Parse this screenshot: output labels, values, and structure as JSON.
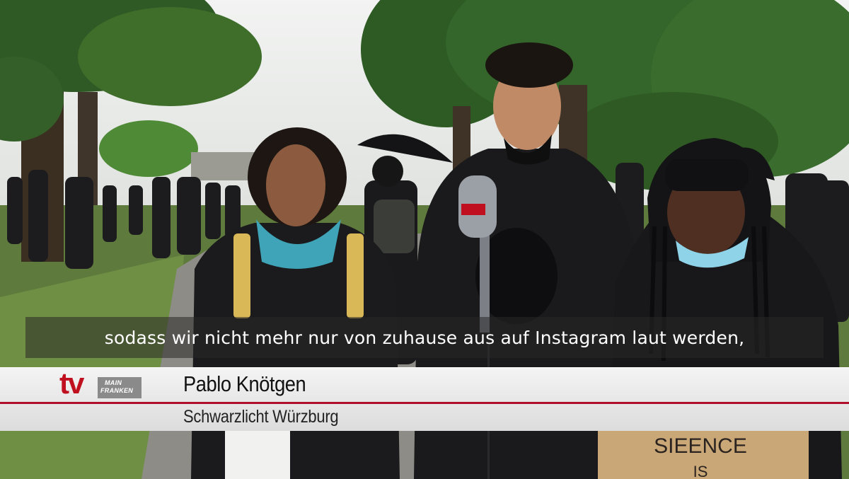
{
  "subtitle": "sodass wir nicht mehr nur von zuhause aus auf Instagram laut werden,",
  "lower_third": {
    "name": "Pablo Knötgen",
    "organization": "Schwarzlicht Würzburg"
  },
  "logo": {
    "mark": "tv",
    "line1": "MAIN",
    "line2": "FRANKEN"
  },
  "sign_text": "SIEENCE",
  "sign_text2": "IS",
  "colors": {
    "brand_red": "#c0101f",
    "accent_line": "#b0102a"
  }
}
